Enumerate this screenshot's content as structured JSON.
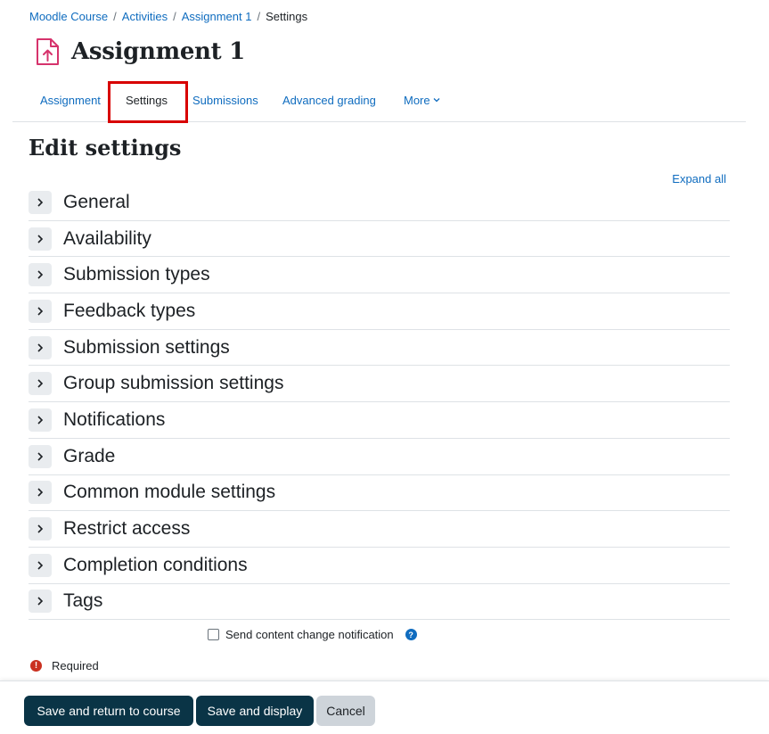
{
  "breadcrumb": {
    "items": [
      "Moodle Course",
      "Activities",
      "Assignment 1"
    ],
    "current": "Settings"
  },
  "header": {
    "title": "Assignment 1",
    "icon": "assignment-upload-icon"
  },
  "nav": {
    "tabs": [
      "Assignment",
      "Settings",
      "Submissions",
      "Advanced grading",
      "More"
    ],
    "active": "Settings"
  },
  "main": {
    "title": "Edit settings",
    "expand_all": "Expand all",
    "sections": [
      "General",
      "Availability",
      "Submission types",
      "Feedback types",
      "Submission settings",
      "Group submission settings",
      "Notifications",
      "Grade",
      "Common module settings",
      "Restrict access",
      "Completion conditions",
      "Tags"
    ],
    "notify_label": "Send content change notification",
    "help_glyph": "?",
    "required_label": "Required",
    "required_glyph": "!"
  },
  "footer": {
    "save_return": "Save and return to course",
    "save_display": "Save and display",
    "cancel": "Cancel"
  },
  "colors": {
    "link": "#0f6cbf",
    "primary_button": "#0a3446",
    "highlight_box": "#d80000",
    "icon_accent": "#d6336c"
  }
}
